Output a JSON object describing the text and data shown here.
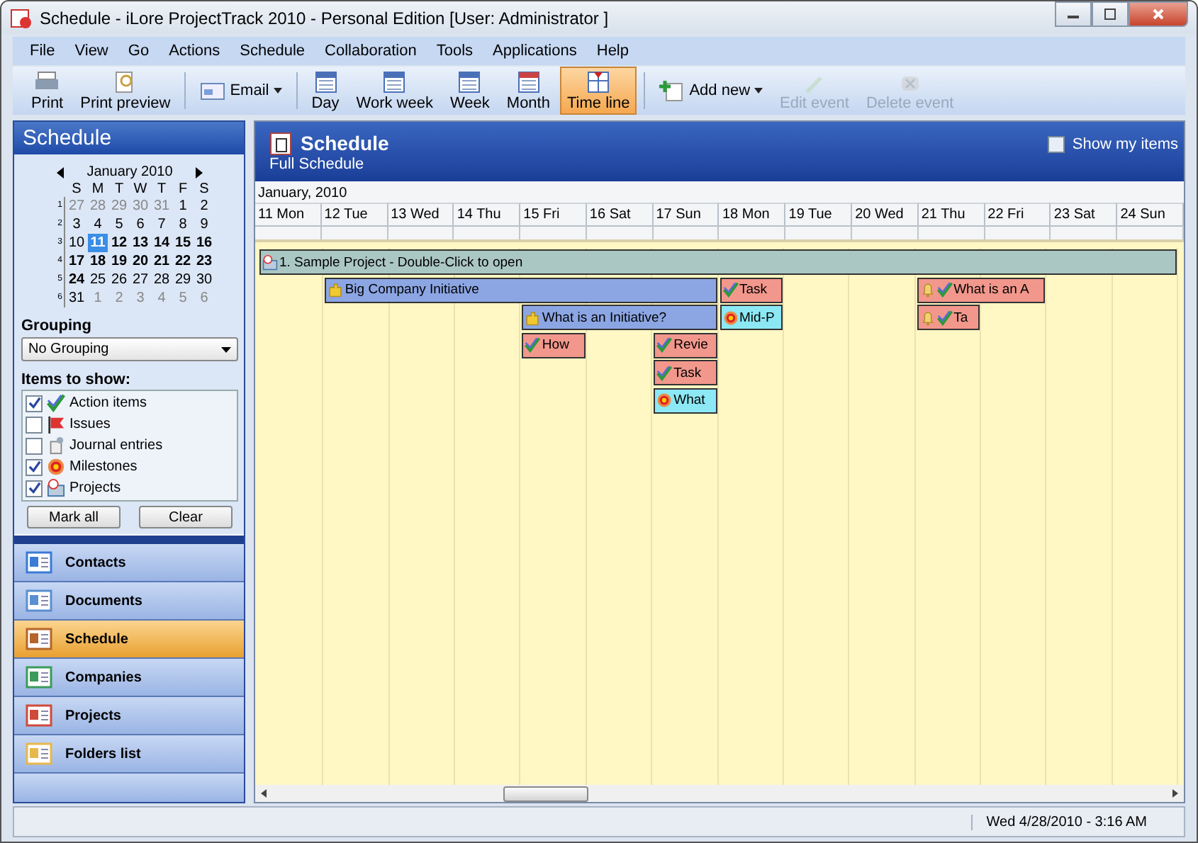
{
  "window": {
    "title": "Schedule - iLore ProjectTrack 2010 - Personal Edition [User: Administrator ]"
  },
  "menu": [
    "File",
    "View",
    "Go",
    "Actions",
    "Schedule",
    "Collaboration",
    "Tools",
    "Applications",
    "Help"
  ],
  "toolbar": [
    {
      "label": "Print",
      "kind": "stacked",
      "selected": false,
      "disabled": false
    },
    {
      "label": "Print preview",
      "kind": "stacked",
      "selected": false,
      "disabled": false
    },
    {
      "label": "Email",
      "kind": "dropdown",
      "selected": false,
      "disabled": false
    },
    {
      "label": "Day",
      "kind": "stacked",
      "selected": false,
      "disabled": false
    },
    {
      "label": "Work week",
      "kind": "stacked",
      "selected": false,
      "disabled": false
    },
    {
      "label": "Week",
      "kind": "stacked",
      "selected": false,
      "disabled": false
    },
    {
      "label": "Month",
      "kind": "stacked",
      "selected": false,
      "disabled": false
    },
    {
      "label": "Time line",
      "kind": "stacked",
      "selected": true,
      "disabled": false
    },
    {
      "label": "Add new",
      "kind": "dropdown",
      "selected": false,
      "disabled": false
    },
    {
      "label": "Edit event",
      "kind": "stacked",
      "selected": false,
      "disabled": true
    },
    {
      "label": "Delete event",
      "kind": "stacked",
      "selected": false,
      "disabled": true
    }
  ],
  "sidebar": {
    "title": "Schedule",
    "calendar": {
      "month": "January 2010",
      "weekdays": [
        "S",
        "M",
        "T",
        "W",
        "T",
        "F",
        "S"
      ],
      "weeks": [
        {
          "number": "1",
          "days": [
            {
              "d": "27",
              "other": true,
              "bold": false,
              "selected": false
            },
            {
              "d": "28",
              "other": true,
              "bold": false,
              "selected": false
            },
            {
              "d": "29",
              "other": true,
              "bold": false,
              "selected": false
            },
            {
              "d": "30",
              "other": true,
              "bold": false,
              "selected": false
            },
            {
              "d": "31",
              "other": true,
              "bold": false,
              "selected": false
            },
            {
              "d": "1",
              "other": false,
              "bold": false,
              "selected": false
            },
            {
              "d": "2",
              "other": false,
              "bold": false,
              "selected": false
            }
          ]
        },
        {
          "number": "2",
          "days": [
            {
              "d": "3",
              "other": false,
              "bold": false,
              "selected": false
            },
            {
              "d": "4",
              "other": false,
              "bold": false,
              "selected": false
            },
            {
              "d": "5",
              "other": false,
              "bold": false,
              "selected": false
            },
            {
              "d": "6",
              "other": false,
              "bold": false,
              "selected": false
            },
            {
              "d": "7",
              "other": false,
              "bold": false,
              "selected": false
            },
            {
              "d": "8",
              "other": false,
              "bold": false,
              "selected": false
            },
            {
              "d": "9",
              "other": false,
              "bold": false,
              "selected": false
            }
          ]
        },
        {
          "number": "3",
          "days": [
            {
              "d": "10",
              "other": false,
              "bold": false,
              "selected": false
            },
            {
              "d": "11",
              "other": false,
              "bold": true,
              "selected": true
            },
            {
              "d": "12",
              "other": false,
              "bold": true,
              "selected": false
            },
            {
              "d": "13",
              "other": false,
              "bold": true,
              "selected": false
            },
            {
              "d": "14",
              "other": false,
              "bold": true,
              "selected": false
            },
            {
              "d": "15",
              "other": false,
              "bold": true,
              "selected": false
            },
            {
              "d": "16",
              "other": false,
              "bold": true,
              "selected": false
            }
          ]
        },
        {
          "number": "4",
          "days": [
            {
              "d": "17",
              "other": false,
              "bold": true,
              "selected": false
            },
            {
              "d": "18",
              "other": false,
              "bold": true,
              "selected": false
            },
            {
              "d": "19",
              "other": false,
              "bold": true,
              "selected": false
            },
            {
              "d": "20",
              "other": false,
              "bold": true,
              "selected": false
            },
            {
              "d": "21",
              "other": false,
              "bold": true,
              "selected": false
            },
            {
              "d": "22",
              "other": false,
              "bold": true,
              "selected": false
            },
            {
              "d": "23",
              "other": false,
              "bold": true,
              "selected": false
            }
          ]
        },
        {
          "number": "5",
          "days": [
            {
              "d": "24",
              "other": false,
              "bold": true,
              "selected": false
            },
            {
              "d": "25",
              "other": false,
              "bold": false,
              "selected": false
            },
            {
              "d": "26",
              "other": false,
              "bold": false,
              "selected": false
            },
            {
              "d": "27",
              "other": false,
              "bold": false,
              "selected": false
            },
            {
              "d": "28",
              "other": false,
              "bold": false,
              "selected": false
            },
            {
              "d": "29",
              "other": false,
              "bold": false,
              "selected": false
            },
            {
              "d": "30",
              "other": false,
              "bold": false,
              "selected": false
            }
          ]
        },
        {
          "number": "6",
          "days": [
            {
              "d": "31",
              "other": false,
              "bold": false,
              "selected": false
            },
            {
              "d": "1",
              "other": true,
              "bold": false,
              "selected": false
            },
            {
              "d": "2",
              "other": true,
              "bold": false,
              "selected": false
            },
            {
              "d": "3",
              "other": true,
              "bold": false,
              "selected": false
            },
            {
              "d": "4",
              "other": true,
              "bold": false,
              "selected": false
            },
            {
              "d": "5",
              "other": true,
              "bold": false,
              "selected": false
            },
            {
              "d": "6",
              "other": true,
              "bold": false,
              "selected": false
            }
          ]
        }
      ]
    },
    "grouping_label": "Grouping",
    "grouping_value": "No Grouping",
    "items_label": "Items to show:",
    "items": [
      {
        "label": "Action items",
        "kind": "action",
        "checked": true
      },
      {
        "label": "Issues",
        "kind": "issue",
        "checked": false
      },
      {
        "label": "Journal entries",
        "kind": "journal",
        "checked": false
      },
      {
        "label": "Milestones",
        "kind": "milestone",
        "checked": true
      },
      {
        "label": "Projects",
        "kind": "project",
        "checked": true
      }
    ],
    "buttons": [
      "Mark all",
      "Clear"
    ],
    "nav": [
      {
        "label": "Contacts",
        "selected": false
      },
      {
        "label": "Documents",
        "selected": false
      },
      {
        "label": "Schedule",
        "selected": true
      },
      {
        "label": "Companies",
        "selected": false
      },
      {
        "label": "Projects",
        "selected": false
      },
      {
        "label": "Folders list",
        "selected": false
      }
    ]
  },
  "main": {
    "title": "Schedule",
    "subtitle": "Full Schedule",
    "show_my_items": {
      "label": "Show my items",
      "checked": false
    },
    "month": "January, 2010",
    "days": [
      "11 Mon",
      "12 Tue",
      "13 Wed",
      "14 Thu",
      "15 Fri",
      "16 Sat",
      "17 Sun",
      "18 Mon",
      "19 Tue",
      "20 Wed",
      "21 Thu",
      "22 Fri",
      "23 Sat",
      "24 Sun"
    ],
    "events": [
      {
        "label": "1. Sample Project - Double-Click to open",
        "kind": "project",
        "reminder": false
      },
      {
        "label": "Big Company Initiative",
        "kind": "initiative",
        "reminder": false
      },
      {
        "label": "Task",
        "kind": "action",
        "reminder": false
      },
      {
        "label": "What is an A",
        "kind": "action",
        "reminder": true
      },
      {
        "label": "What is an Initiative?",
        "kind": "initiative",
        "reminder": false
      },
      {
        "label": "Mid-P",
        "kind": "milestone",
        "reminder": false
      },
      {
        "label": "Ta",
        "kind": "action",
        "reminder": true
      },
      {
        "label": "How",
        "kind": "action",
        "reminder": false
      },
      {
        "label": "Revie",
        "kind": "action",
        "reminder": false
      },
      {
        "label": "Task",
        "kind": "action",
        "reminder": false
      },
      {
        "label": "What",
        "kind": "milestone",
        "reminder": false
      }
    ]
  },
  "status_bar": {
    "datetime": "Wed 4/28/2010 - 3:16 AM"
  }
}
